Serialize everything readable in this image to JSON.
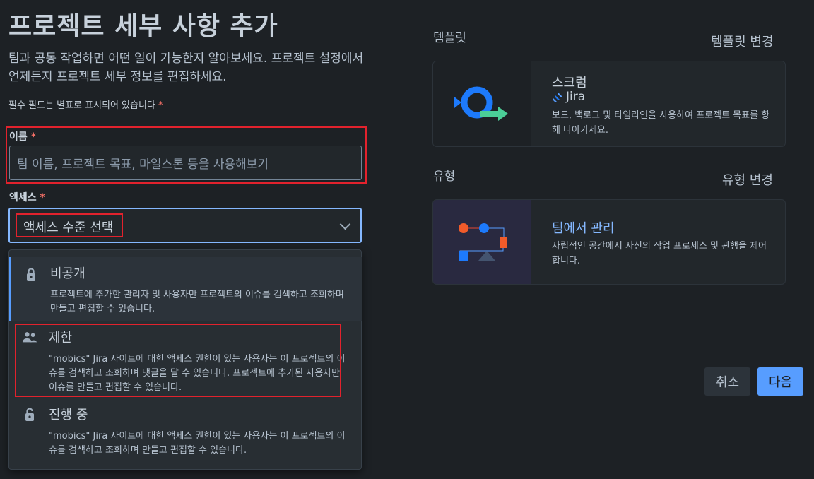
{
  "page": {
    "title": "프로젝트 세부 사항 추가",
    "description": "팀과 공동 작업하면 어떤 일이 가능한지 알아보세요. 프로젝트 설정에서 언제든지 프로젝트 세부 정보를 편집하세요.",
    "required_note": "필수 필드는 별표로 표시되어 있습니다",
    "required_star": "*"
  },
  "form": {
    "name_label": "이름",
    "name_placeholder": "팀 이름, 프로젝트 목표, 마일스톤 등을 사용해보기",
    "access_label": "액세스",
    "access_selected": "액세스 수준 선택"
  },
  "access_options": [
    {
      "icon": "lock-icon",
      "title": "비공개",
      "description": "프로젝트에 추가한 관리자 및 사용자만 프로젝트의 이슈를 검색하고 조회하며 만들고 편집할 수 있습니다."
    },
    {
      "icon": "people-icon",
      "title": "제한",
      "description": "\"mobics\" Jira 사이트에 대한 액세스 권한이 있는 사용자는 이 프로젝트의 이슈를 검색하고 조회하며 댓글을 달 수 있습니다. 프로젝트에 추가된 사용자만 이슈를 만들고 편집할 수 있습니다."
    },
    {
      "icon": "unlock-icon",
      "title": "진행 중",
      "description": "\"mobics\" Jira 사이트에 대한 액세스 권한이 있는 사용자는 이 프로젝트의 이슈를 검색하고 조회하며 만들고 편집할 수 있습니다."
    }
  ],
  "template": {
    "section_label": "템플릿",
    "change_label": "템플릿 변경",
    "card_title": "스크럼",
    "card_product": "Jira",
    "card_description": "보드, 백로그 및 타임라인을 사용하여 프로젝트 목표를 향해 나아가세요."
  },
  "type": {
    "section_label": "유형",
    "change_label": "유형 변경",
    "card_title": "팀에서 관리",
    "card_description": "자립적인 공간에서 자신의 작업 프로세스 및 관행을 제어합니다."
  },
  "actions": {
    "cancel_label": "취소",
    "next_label": "다음"
  },
  "colors": {
    "accent": "#579dff",
    "link_title": "#85b8ff",
    "error_outline": "#e2222d"
  }
}
